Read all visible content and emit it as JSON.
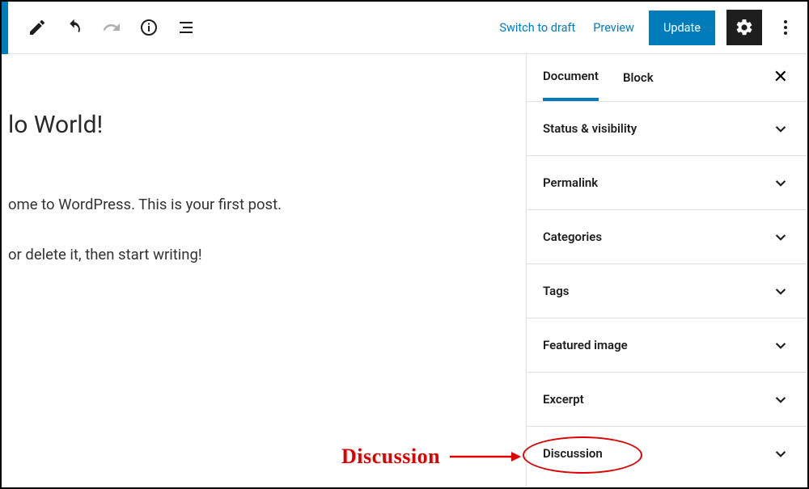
{
  "toolbar": {
    "switch_to_draft": "Switch to draft",
    "preview": "Preview",
    "update": "Update"
  },
  "post": {
    "title": "lo World!",
    "p1": "ome to WordPress. This is your first post.",
    "p2": "or delete it, then start writing!"
  },
  "sidebar": {
    "tabs": {
      "document": "Document",
      "block": "Block"
    },
    "panels": [
      "Status & visibility",
      "Permalink",
      "Categories",
      "Tags",
      "Featured image",
      "Excerpt",
      "Discussion"
    ]
  },
  "annotation": {
    "label": "Discussion"
  }
}
